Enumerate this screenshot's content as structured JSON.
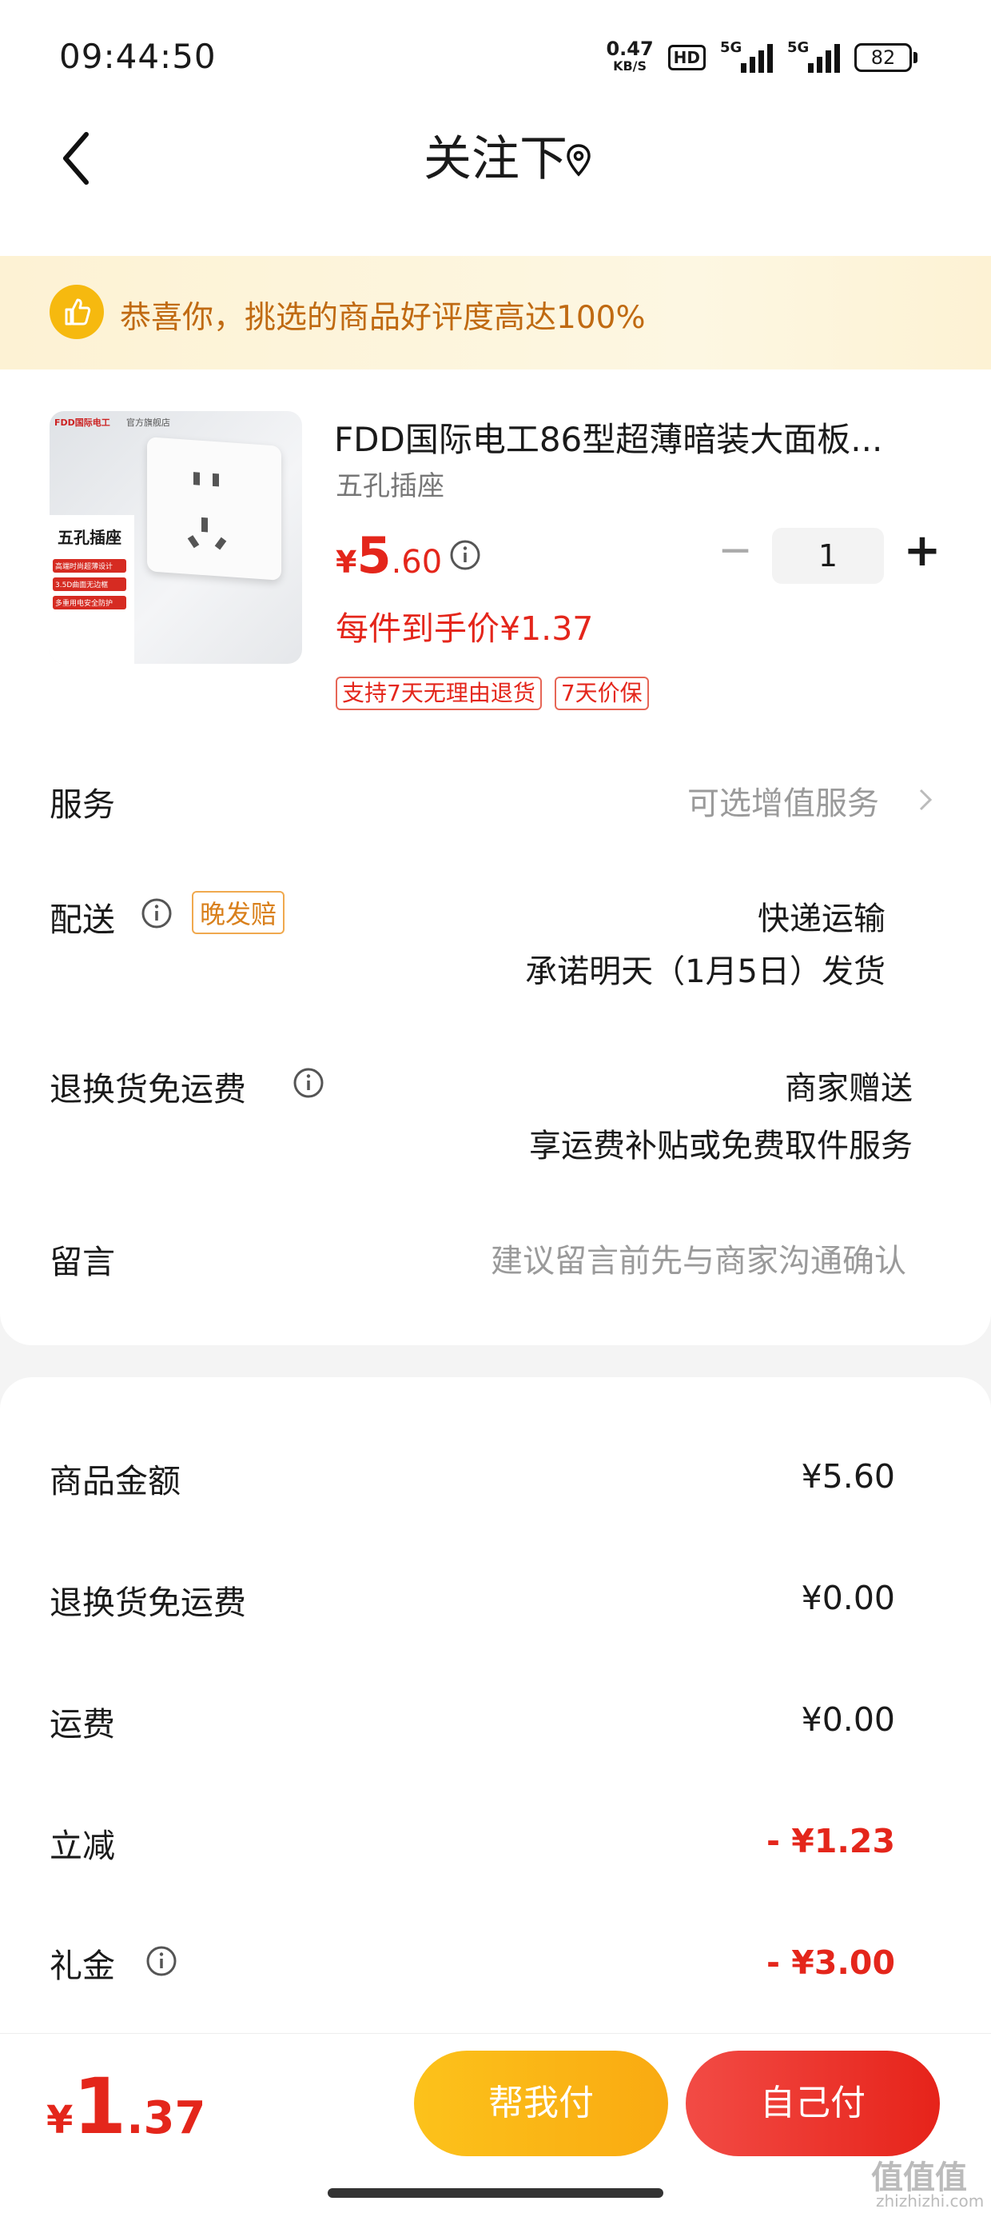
{
  "status_bar": {
    "time": "09:44:50",
    "net_speed_value": "0.47",
    "net_speed_unit": "KB/S",
    "hd_label": "HD",
    "sim1_label": "5G",
    "sim2_label": "5G",
    "battery": "82"
  },
  "header": {
    "title": "关注下"
  },
  "banner": {
    "text": "恭喜你，挑选的商品好评度高达100%"
  },
  "product": {
    "name": "FDD国际电工86型超薄暗装大面板...",
    "spec": "五孔插座",
    "price_currency": "¥",
    "price_int": "5",
    "price_dec": ".60",
    "quantity": "1",
    "per_price": "每件到手价¥1.37",
    "tags": [
      "支持7天无理由退货",
      "7天价保"
    ],
    "image_brand": "FDD国际电工",
    "image_store": "官方旗舰店",
    "image_title": "五孔插座",
    "image_features": [
      "高端时尚超薄设计",
      "3.5D曲面无边框",
      "多重用电安全防护"
    ]
  },
  "rows": {
    "service_label": "服务",
    "service_value": "可选增值服务",
    "delivery_label": "配送",
    "delivery_badge": "晚发赔",
    "delivery_method": "快递运输",
    "delivery_promise": "承诺明天（1月5日）发货",
    "return_label": "退换货免运费",
    "return_value": "商家赠送",
    "return_desc": "享运费补贴或免费取件服务",
    "message_label": "留言",
    "message_placeholder": "建议留言前先与商家沟通确认"
  },
  "summary": [
    {
      "label": "商品金额",
      "value": "¥5.60"
    },
    {
      "label": "退换货免运费",
      "value": "¥0.00"
    },
    {
      "label": "运费",
      "value": "¥0.00"
    },
    {
      "label": "立减",
      "value": "- ¥1.23"
    },
    {
      "label": "礼金",
      "value": "- ¥3.00"
    }
  ],
  "footer": {
    "total_currency": "¥",
    "total_int": "1",
    "total_dec": ".37",
    "help_pay": "帮我付",
    "self_pay": "自己付"
  },
  "watermark": {
    "logo": "值值值",
    "url": "zhizhizhi.com"
  },
  "colors": {
    "accent_red": "#e4261b",
    "banner_text": "#c06a12",
    "help_button": "#fcc21b",
    "self_button": "#f24b45"
  }
}
